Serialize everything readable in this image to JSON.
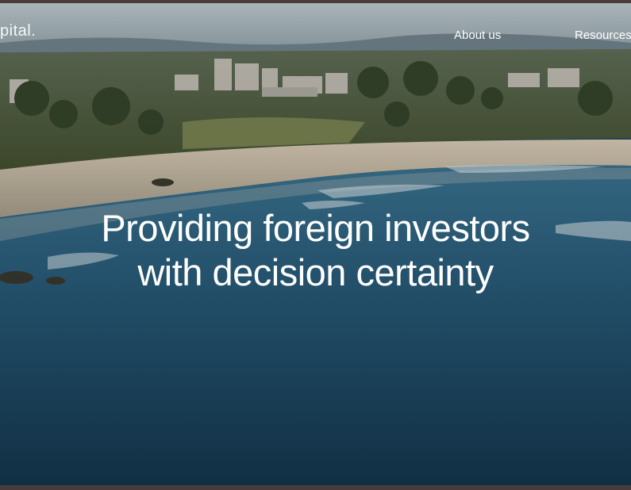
{
  "nav": {
    "logo_text": "pital.",
    "links": [
      {
        "label": "About us"
      },
      {
        "label": "Resources"
      }
    ]
  },
  "hero": {
    "line1": "Providing foreign investors",
    "line2": "with decision certainty"
  },
  "colors": {
    "page_border": "#4a3b3b",
    "ocean_deep": "#173f5a",
    "ocean_mid": "#285f80",
    "sand": "#cbbda8",
    "foliage": "#4b5a3a",
    "text": "#ffffff"
  }
}
